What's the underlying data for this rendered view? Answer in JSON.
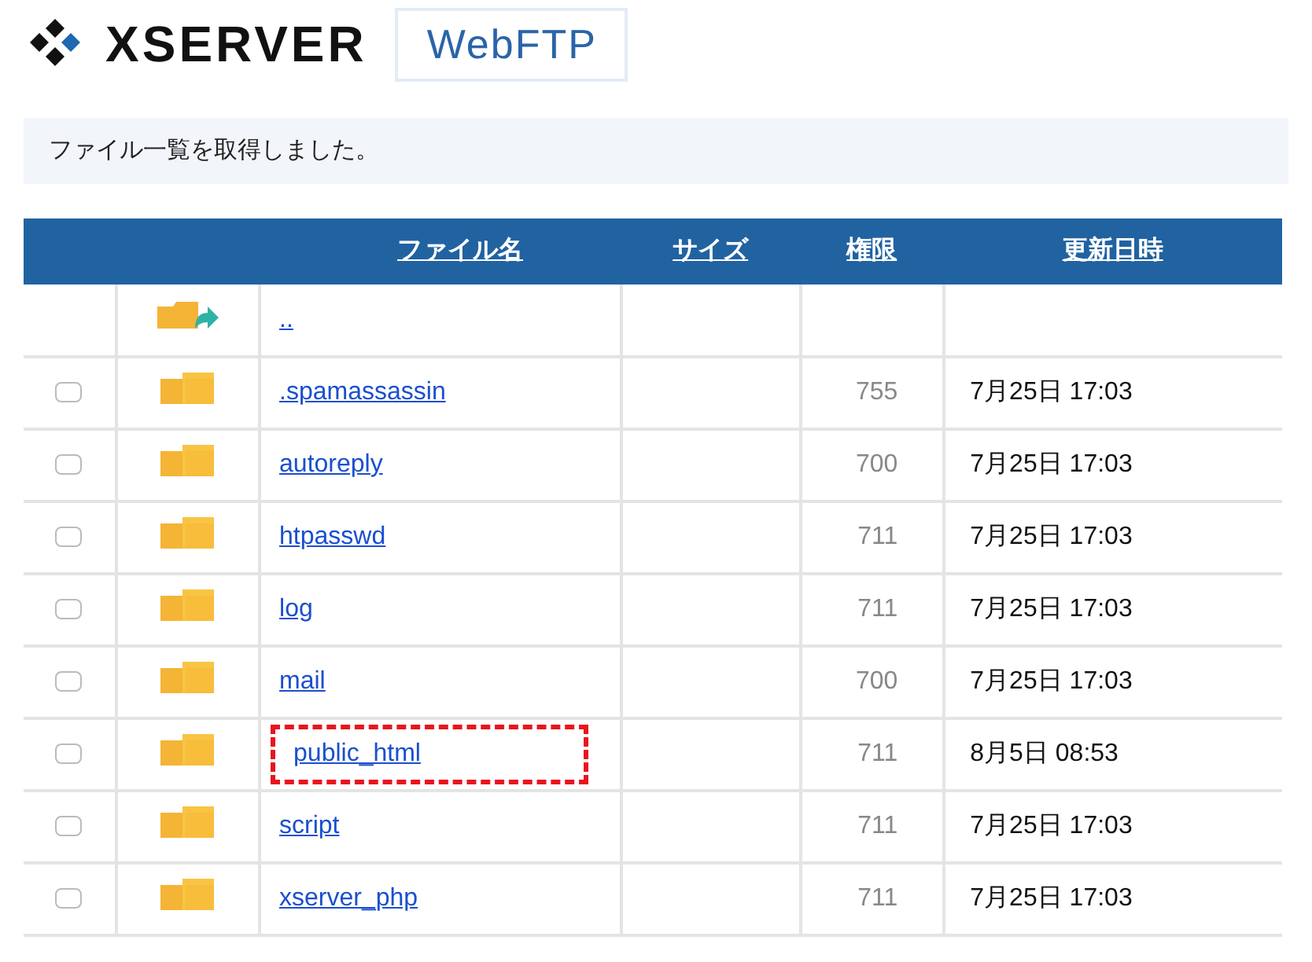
{
  "header": {
    "logo": "XSERVER",
    "app_badge": "WebFTP"
  },
  "message": "ファイル一覧を取得しました。",
  "table": {
    "columns": [
      "ファイル名",
      "サイズ",
      "権限",
      "更新日時"
    ],
    "rows": [
      {
        "kind": "parent",
        "name": "..",
        "highlighted": false
      },
      {
        "kind": "folder",
        "name": ".spamassassin",
        "permission": "755",
        "modified": "7月25日 17:03",
        "checked": false,
        "highlighted": false
      },
      {
        "kind": "folder",
        "name": "autoreply",
        "permission": "700",
        "modified": "7月25日 17:03",
        "checked": false,
        "highlighted": false
      },
      {
        "kind": "folder",
        "name": "htpasswd",
        "permission": "711",
        "modified": "7月25日 17:03",
        "checked": false,
        "highlighted": false
      },
      {
        "kind": "folder",
        "name": "log",
        "permission": "711",
        "modified": "7月25日 17:03",
        "checked": false,
        "highlighted": false
      },
      {
        "kind": "folder",
        "name": "mail",
        "permission": "700",
        "modified": "7月25日 17:03",
        "checked": false,
        "highlighted": false
      },
      {
        "kind": "folder",
        "name": "public_html",
        "permission": "711",
        "modified": "8月5日 08:53",
        "checked": false,
        "highlighted": true
      },
      {
        "kind": "folder",
        "name": "script",
        "permission": "711",
        "modified": "7月25日 17:03",
        "checked": false,
        "highlighted": false
      },
      {
        "kind": "folder",
        "name": "xserver_php",
        "permission": "711",
        "modified": "7月25日 17:03",
        "checked": false,
        "highlighted": false
      }
    ]
  }
}
